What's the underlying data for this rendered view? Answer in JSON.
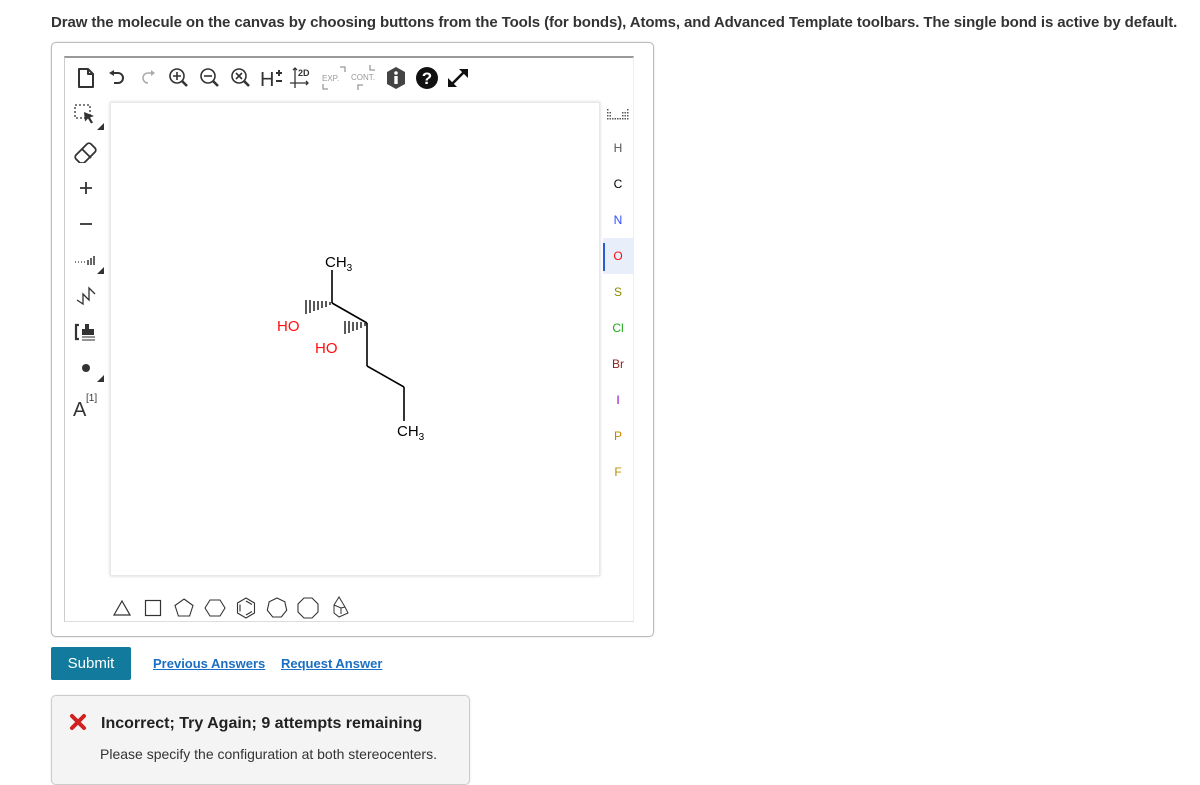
{
  "instructions": "Draw the molecule on the canvas by choosing buttons from the Tools (for bonds), Atoms, and Advanced Template toolbars. The single bond is active by default.",
  "top_toolbar": [
    {
      "name": "new-document",
      "icon": "file-icon"
    },
    {
      "name": "undo",
      "icon": "undo-icon"
    },
    {
      "name": "redo",
      "icon": "redo-icon",
      "disabled": true
    },
    {
      "name": "zoom-in",
      "icon": "zoom-in-icon"
    },
    {
      "name": "zoom-out",
      "icon": "zoom-out-icon"
    },
    {
      "name": "zoom-reset",
      "icon": "zoom-reset-icon"
    },
    {
      "name": "toggle-hydrogens",
      "icon": "h-plus-minus-icon",
      "label": "H"
    },
    {
      "name": "clean-2d",
      "icon": "clean-2d-icon",
      "label": "2D"
    },
    {
      "name": "expand",
      "icon": "expand-icon",
      "label": "EXP.",
      "disabled": true
    },
    {
      "name": "contract",
      "icon": "contract-icon",
      "label": "CONT.",
      "disabled": true
    },
    {
      "name": "info",
      "icon": "info-icon"
    },
    {
      "name": "help",
      "icon": "help-icon"
    },
    {
      "name": "fullscreen",
      "icon": "fullscreen-icon"
    }
  ],
  "left_toolbar": [
    {
      "name": "select",
      "icon": "select-icon"
    },
    {
      "name": "erase",
      "icon": "eraser-icon"
    },
    {
      "name": "charge-plus",
      "icon": "plus-icon",
      "label": "+"
    },
    {
      "name": "charge-minus",
      "icon": "minus-icon",
      "label": "−"
    },
    {
      "name": "bond",
      "icon": "bond-icon"
    },
    {
      "name": "chain",
      "icon": "chain-icon"
    },
    {
      "name": "sgroup",
      "icon": "sgroup-icon"
    },
    {
      "name": "radical",
      "icon": "radical-dot-icon"
    },
    {
      "name": "atom-map",
      "icon": "atom-map-icon",
      "label": "A",
      "sup": "[1]"
    }
  ],
  "atoms": {
    "periodic_table": "periodic-table-icon",
    "items": [
      {
        "symbol": "H",
        "color": "#555555"
      },
      {
        "symbol": "C",
        "color": "#000000"
      },
      {
        "symbol": "N",
        "color": "#304ff7"
      },
      {
        "symbol": "O",
        "color": "#ff0d0d",
        "active": true
      },
      {
        "symbol": "S",
        "color": "#8a8a00"
      },
      {
        "symbol": "Cl",
        "color": "#1ba81b"
      },
      {
        "symbol": "Br",
        "color": "#8b2323"
      },
      {
        "symbol": "I",
        "color": "#8b00c8"
      },
      {
        "symbol": "P",
        "color": "#d08000"
      },
      {
        "symbol": "F",
        "color": "#b89000"
      }
    ]
  },
  "templates": [
    {
      "name": "cyclopropane",
      "icon": "triangle-icon"
    },
    {
      "name": "cyclobutane",
      "icon": "square-icon"
    },
    {
      "name": "cyclopentane",
      "icon": "pentagon-icon"
    },
    {
      "name": "cyclohexane",
      "icon": "hexagon-icon"
    },
    {
      "name": "benzene",
      "icon": "benzene-icon"
    },
    {
      "name": "cycloheptane",
      "icon": "heptagon-icon"
    },
    {
      "name": "cyclooctane",
      "icon": "octagon-icon"
    },
    {
      "name": "bicyclo",
      "icon": "bicyclic-icon"
    }
  ],
  "molecule": {
    "labels": {
      "ch3_top": "CH",
      "ch3_top_sub": "3",
      "ho_1": "HO",
      "ho_2": "HO",
      "ch3_bottom": "CH",
      "ch3_bottom_sub": "3"
    },
    "hetero_color": "#ff0d0d"
  },
  "actions": {
    "submit": "Submit",
    "previous_answers": "Previous Answers",
    "request_answer": "Request Answer"
  },
  "feedback": {
    "title": "Incorrect; Try Again; 9 attempts remaining",
    "message": "Please specify the configuration at both stereocenters.",
    "status_color": "#d21f1f"
  },
  "colors": {
    "submit_bg": "#117a9d",
    "link": "#1b6ec2",
    "active_atom_bar": "#2a5bd7"
  }
}
